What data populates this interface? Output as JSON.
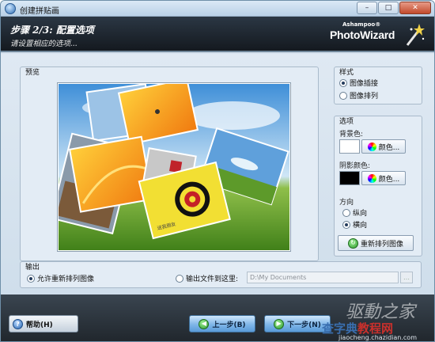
{
  "window": {
    "title": "创建拼贴画",
    "minimize": "–",
    "maximize": "□",
    "close": "✕"
  },
  "header": {
    "step": "步骤 2/3: 配置选项",
    "subtitle": "请设置相应的选项...",
    "logo_small": "Ashampoo®",
    "logo_big": "PhotoWizard"
  },
  "preview": {
    "label": "预览",
    "mini_text": "送我朋友"
  },
  "style": {
    "label": "样式",
    "options": [
      "图像插接",
      "图像排列"
    ],
    "selected": 0
  },
  "options": {
    "label": "选项",
    "background_label": "背景色:",
    "background_color": "#ffffff",
    "color_button": "颜色...",
    "shadow_label": "阴影颜色:",
    "shadow_color": "#000000",
    "direction_label": "方向",
    "directions": [
      "纵向",
      "横向"
    ],
    "direction_selected": 1,
    "rearrange_button": "重新排列图像"
  },
  "output": {
    "label": "输出",
    "allow_rearrange": "允许重新排列图像",
    "output_to": "输出文件到这里:",
    "path": "D:\\My Documents",
    "browse": "…",
    "selected": 0
  },
  "footer": {
    "help": "帮助(H)",
    "back": "上一步(B)",
    "next": "下一步(N)"
  },
  "watermark": {
    "line1": "驱動之家",
    "line2a": "查字典",
    "line2b": "教程网",
    "line3": "jiaocheng.chazidian.com"
  }
}
